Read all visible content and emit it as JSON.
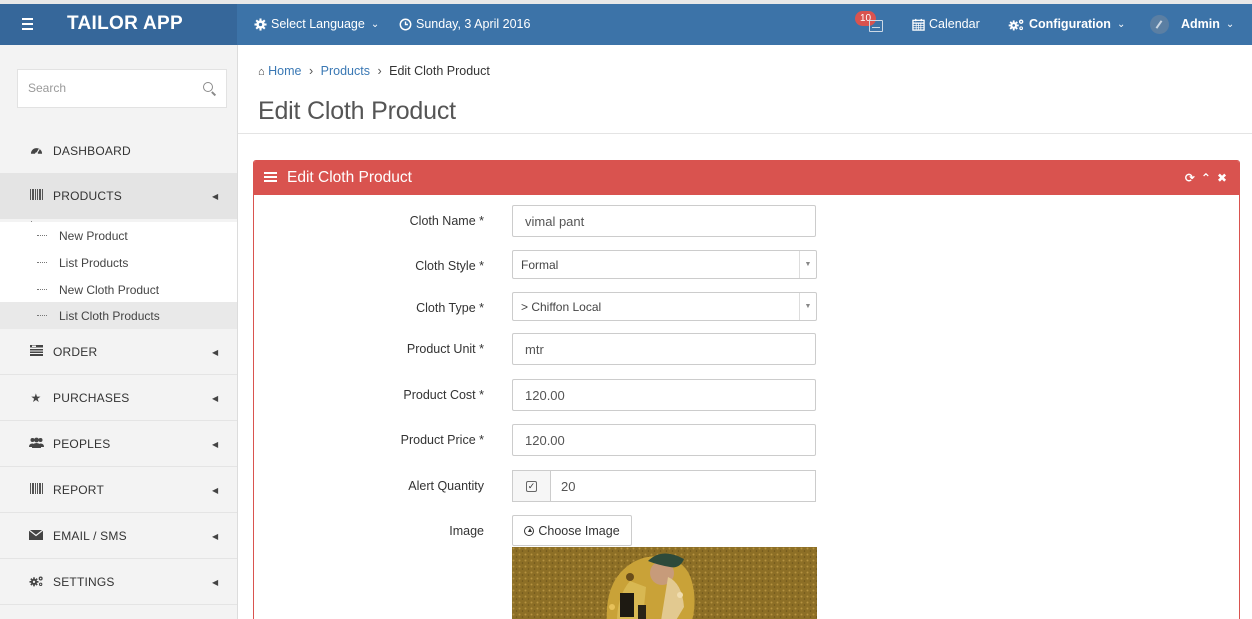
{
  "app": {
    "brand": "TAILOR APP",
    "select_language": "Select Language",
    "date": "Sunday, 3 April 2016",
    "notifications_count": "10",
    "calendar": "Calendar",
    "configuration": "Configuration",
    "user": "Admin"
  },
  "sidebar": {
    "search_placeholder": "Search",
    "items": [
      {
        "label": "DASHBOARD",
        "icon": "dashboard-icon"
      },
      {
        "label": "PRODUCTS",
        "icon": "barcode-icon"
      },
      {
        "label": "ORDER",
        "icon": "list-icon"
      },
      {
        "label": "PURCHASES",
        "icon": "star-icon"
      },
      {
        "label": "PEOPLES",
        "icon": "users-icon"
      },
      {
        "label": "REPORT",
        "icon": "barcode-icon"
      },
      {
        "label": "EMAIL / SMS",
        "icon": "envelope-icon"
      },
      {
        "label": "SETTINGS",
        "icon": "cogs-icon"
      }
    ],
    "products_sub": [
      "New Product",
      "List Products",
      "New Cloth Product",
      "List Cloth Products"
    ]
  },
  "breadcrumb": {
    "home": "Home",
    "products": "Products",
    "current": "Edit Cloth Product"
  },
  "page_title": "Edit Cloth Product",
  "panel": {
    "title": "Edit Cloth Product",
    "accent": "#d9534f"
  },
  "form": {
    "cloth_name": {
      "label": "Cloth Name *",
      "value": "vimal pant"
    },
    "cloth_style": {
      "label": "Cloth Style *",
      "value": "Formal"
    },
    "cloth_type": {
      "label": "Cloth Type *",
      "value": "> Chiffon Local"
    },
    "product_unit": {
      "label": "Product Unit *",
      "value": "mtr"
    },
    "product_cost": {
      "label": "Product Cost *",
      "value": "120.00"
    },
    "product_price": {
      "label": "Product Price *",
      "value": "120.00"
    },
    "alert_quantity": {
      "label": "Alert Quantity",
      "checked": true,
      "value": "20"
    },
    "image": {
      "label": "Image",
      "button": "Choose Image"
    }
  }
}
